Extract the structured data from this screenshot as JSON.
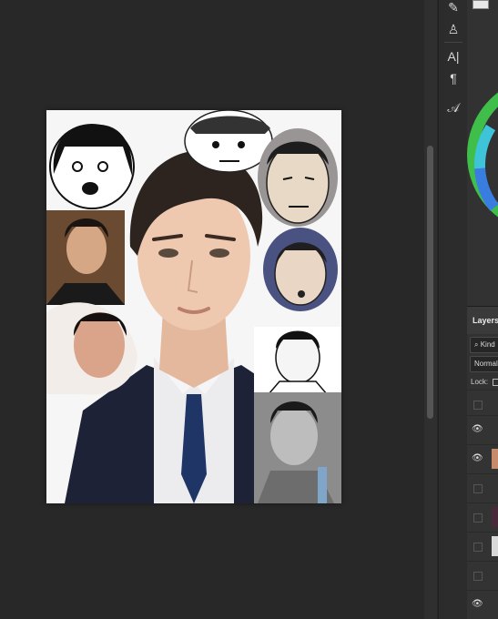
{
  "tools": {
    "items": [
      {
        "name": "pen-tool",
        "glyph": "✎"
      },
      {
        "name": "stamp-tool",
        "glyph": "♙"
      },
      {
        "name": "type-tool",
        "glyph": "A|"
      },
      {
        "name": "paragraph-tool",
        "glyph": "¶"
      },
      {
        "name": "glyph-tool",
        "glyph": "𝒜"
      }
    ]
  },
  "layers_panel": {
    "title": "Layers",
    "filter_label": "Kind",
    "blend_mode": "Normal",
    "lock_label": "Lock:",
    "rows": [
      {
        "visible": false
      },
      {
        "visible": true
      },
      {
        "visible": true
      },
      {
        "visible": false
      },
      {
        "visible": false
      },
      {
        "visible": false
      },
      {
        "visible": false
      },
      {
        "visible": true
      }
    ]
  },
  "colors": {
    "workspace": "#282828",
    "panel": "#323232",
    "toolbar": "#2c2c2c",
    "doc_background": "#f8f8f8"
  }
}
